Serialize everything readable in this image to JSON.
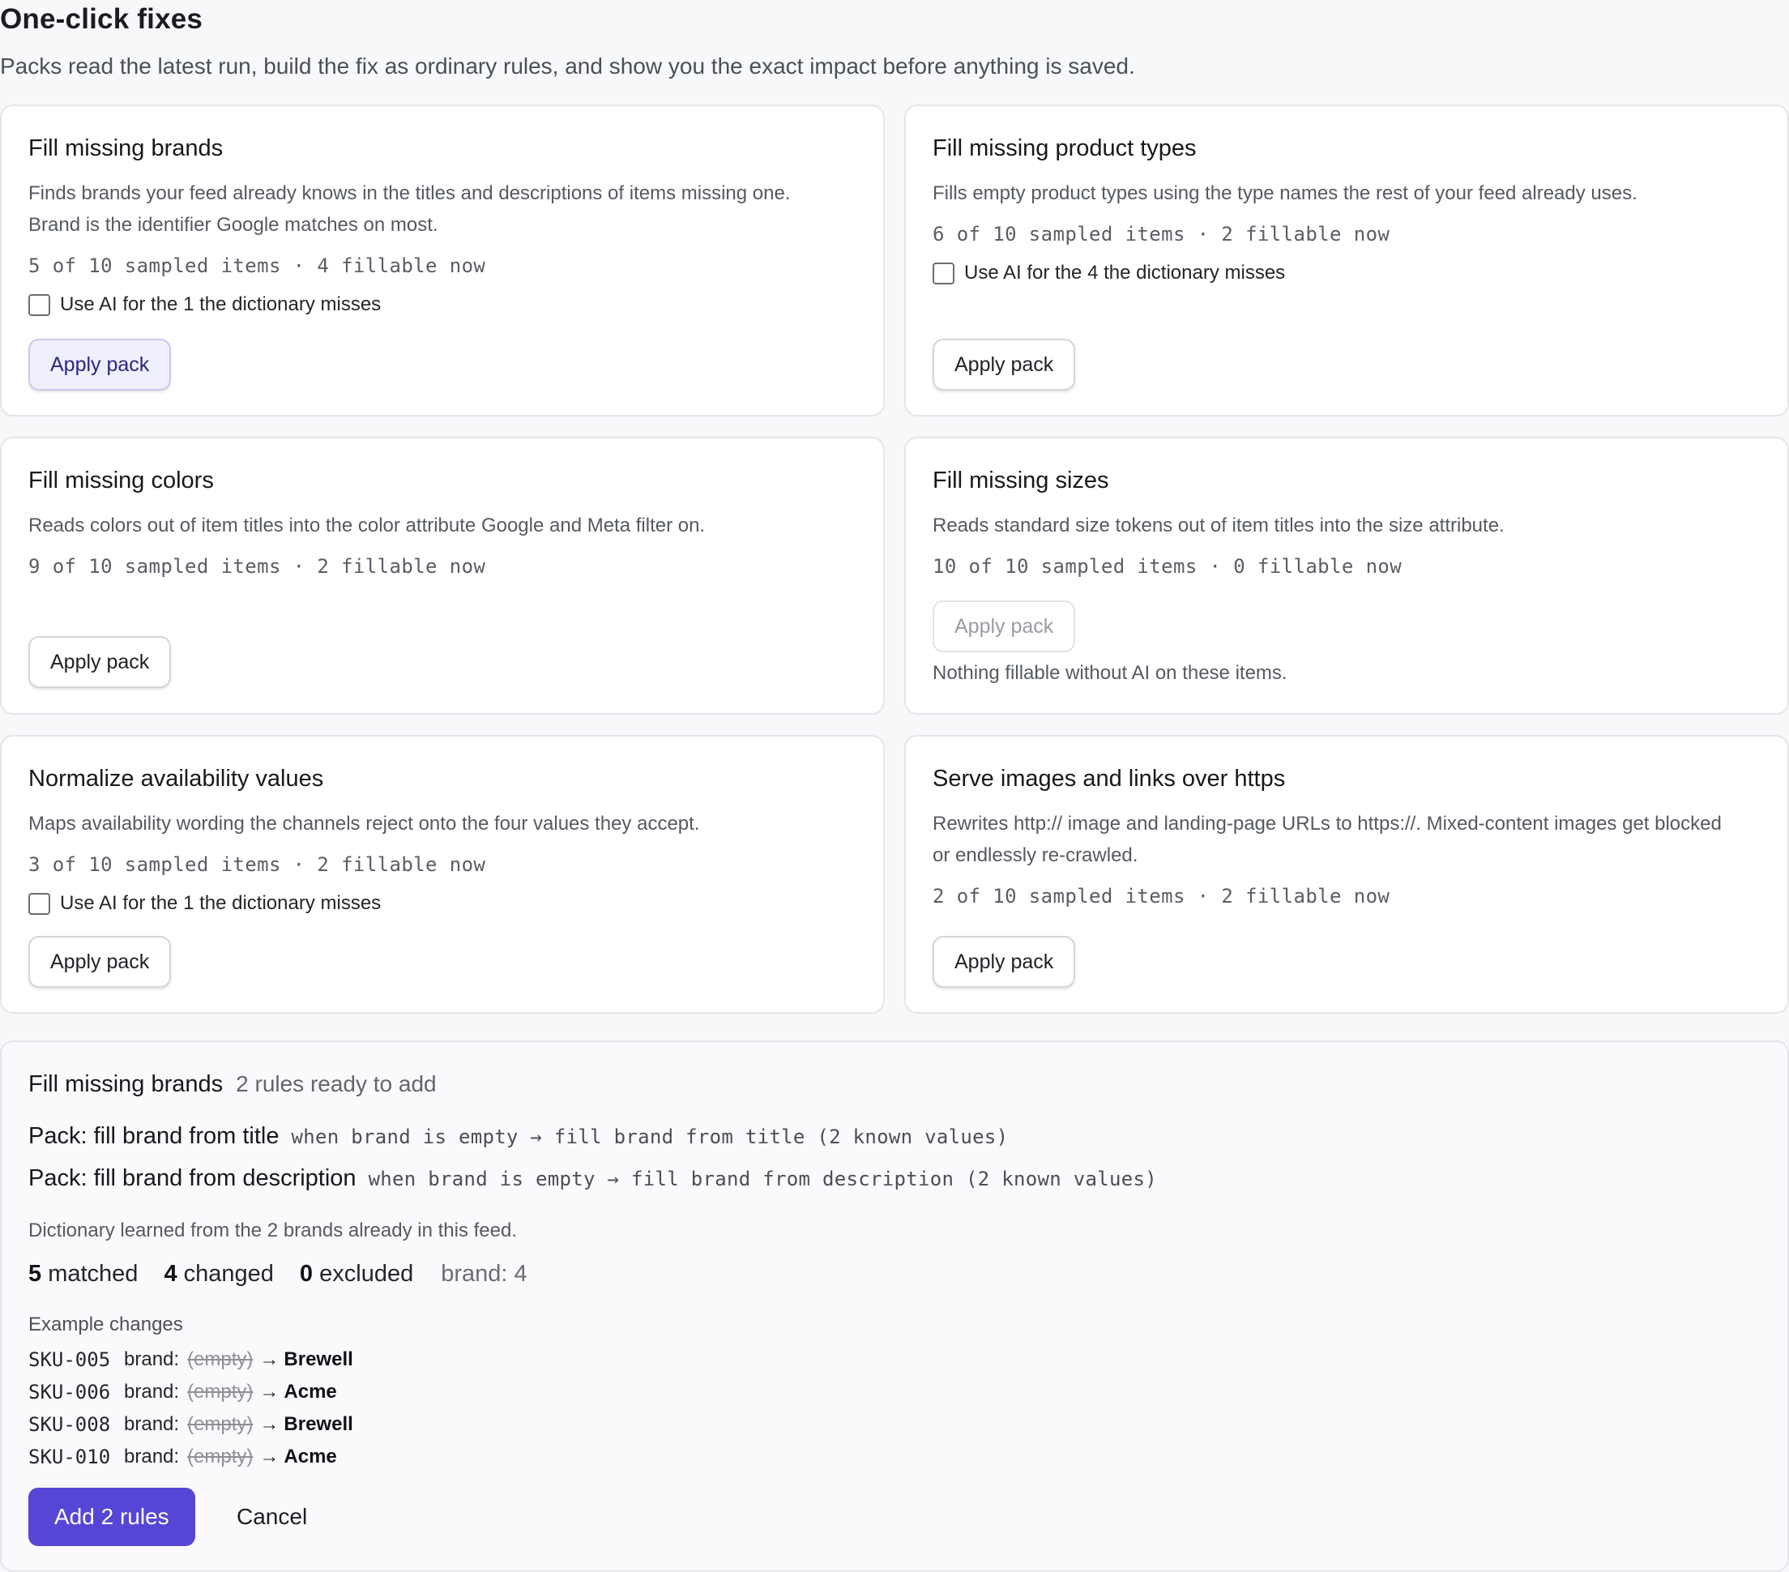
{
  "header": {
    "title": "One-click fixes",
    "subtitle": "Packs read the latest run, build the fix as ordinary rules, and show you the exact impact before anything is saved."
  },
  "packs": [
    {
      "title": "Fill missing brands",
      "desc1": "Finds brands your feed already knows in the titles and descriptions of items missing one.",
      "desc2": "Brand is the identifier Google matches on most.",
      "stats": "5 of 10 sampled items · 4 fillable now",
      "ai_label": "Use AI for the 1 the dictionary misses",
      "ai_checked": false,
      "button": "Apply pack",
      "button_state": "active"
    },
    {
      "title": "Fill missing product types",
      "desc1": "Fills empty product types using the type names the rest of your feed already uses.",
      "stats": "6 of 10 sampled items · 2 fillable now",
      "ai_label": "Use AI for the 4 the dictionary misses",
      "ai_checked": false,
      "button": "Apply pack",
      "button_state": "default"
    },
    {
      "title": "Fill missing colors",
      "desc1": "Reads colors out of item titles into the color attribute Google and Meta filter on.",
      "stats": "9 of 10 sampled items · 2 fillable now",
      "button": "Apply pack",
      "button_state": "default"
    },
    {
      "title": "Fill missing sizes",
      "desc1": "Reads standard size tokens out of item titles into the size attribute.",
      "stats": "10 of 10 sampled items · 0 fillable now",
      "button": "Apply pack",
      "button_state": "disabled",
      "note": "Nothing fillable without AI on these items."
    },
    {
      "title": "Normalize availability values",
      "desc1": "Maps availability wording the channels reject onto the four values they accept.",
      "stats": "3 of 10 sampled items · 2 fillable now",
      "ai_label": "Use AI for the 1 the dictionary misses",
      "ai_checked": false,
      "button": "Apply pack",
      "button_state": "default"
    },
    {
      "title": "Serve images and links over https",
      "desc1": "Rewrites http:// image and landing-page URLs to https://. Mixed-content images get blocked",
      "desc2": "or endlessly re-crawled.",
      "stats": "2 of 10 sampled items · 2 fillable now",
      "button": "Apply pack",
      "button_state": "default"
    }
  ],
  "preview": {
    "title": "Fill missing brands",
    "count_label": "2 rules ready to add",
    "rules": [
      {
        "name": "Pack: fill brand from title",
        "expr": "when brand is empty → fill brand from title (2 known values)"
      },
      {
        "name": "Pack: fill brand from description",
        "expr": "when brand is empty → fill brand from description (2 known values)"
      }
    ],
    "dictionary_note": "Dictionary learned from the 2 brands already in this feed.",
    "metrics": {
      "matched_value": "5",
      "matched_label": "matched",
      "changed_value": "4",
      "changed_label": "changed",
      "excluded_value": "0",
      "excluded_label": "excluded",
      "field_summary": "brand: 4"
    },
    "examples_label": "Example changes",
    "examples": [
      {
        "sku": "SKU-005",
        "field": "brand:",
        "old": "(empty)",
        "arrow": "→",
        "new": "Brewell"
      },
      {
        "sku": "SKU-006",
        "field": "brand:",
        "old": "(empty)",
        "arrow": "→",
        "new": "Acme"
      },
      {
        "sku": "SKU-008",
        "field": "brand:",
        "old": "(empty)",
        "arrow": "→",
        "new": "Brewell"
      },
      {
        "sku": "SKU-010",
        "field": "brand:",
        "old": "(empty)",
        "arrow": "→",
        "new": "Acme"
      }
    ],
    "primary_button": "Add 2 rules",
    "cancel_button": "Cancel"
  },
  "colors": {
    "accent": "#5546d6",
    "active_button_bg": "#f0effd",
    "page_bg": "#f7f8fa"
  }
}
